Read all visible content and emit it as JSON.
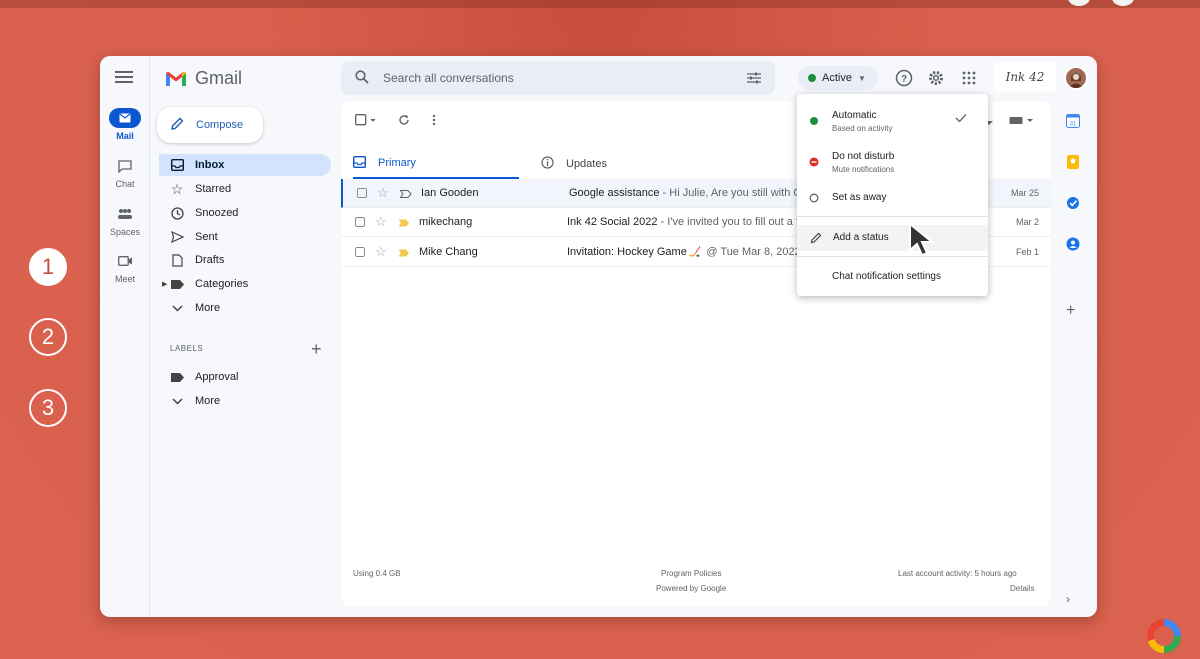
{
  "steps": [
    "1",
    "2",
    "3"
  ],
  "app": {
    "name": "Gmail"
  },
  "rail": {
    "items": [
      {
        "label": "Mail"
      },
      {
        "label": "Chat"
      },
      {
        "label": "Spaces"
      },
      {
        "label": "Meet"
      }
    ]
  },
  "search": {
    "placeholder": "Search all conversations"
  },
  "status": {
    "label": "Active",
    "color": "#1e8e3e"
  },
  "brand": {
    "text": "Ink 42"
  },
  "compose": {
    "label": "Compose"
  },
  "nav": {
    "items": [
      {
        "label": "Inbox",
        "icon": "inbox-icon"
      },
      {
        "label": "Starred",
        "icon": "star-icon"
      },
      {
        "label": "Snoozed",
        "icon": "clock-icon"
      },
      {
        "label": "Sent",
        "icon": "send-icon"
      },
      {
        "label": "Drafts",
        "icon": "draft-icon"
      },
      {
        "label": "Categories",
        "icon": "label-icon"
      },
      {
        "label": "More",
        "icon": "chevron-down-icon"
      }
    ],
    "labels_heading": "LABELS",
    "labels": [
      {
        "label": "Approval"
      },
      {
        "label": "More"
      }
    ]
  },
  "tabs": [
    {
      "label": "Primary"
    },
    {
      "label": "Updates"
    }
  ],
  "emails": [
    {
      "sender": "Ian Gooden",
      "subject": "Google assistance",
      "snippet": " - Hi Julie, Are you still with Go",
      "date": "Mar 25"
    },
    {
      "sender": "mikechang",
      "subject": "Ink 42 Social 2022",
      "snippet": " - I've invited you to fill out a fo",
      "date": "Mar 2"
    },
    {
      "sender": "Mike Chang",
      "subject": "Invitation: Hockey Game",
      "snippet": " @ Tue Mar 8, 2022",
      "date": "Feb 1"
    }
  ],
  "footer": {
    "storage": "Using 0.4 GB",
    "policies": "Program Policies",
    "powered": "Powered by Google",
    "activity": "Last account activity: 5 hours ago",
    "details": "Details"
  },
  "status_menu": {
    "automatic": {
      "label": "Automatic",
      "sub": "Based on activity"
    },
    "dnd": {
      "label": "Do not disturb",
      "sub": "Mute notifications"
    },
    "away": {
      "label": "Set as away"
    },
    "add_status": {
      "label": "Add a status"
    },
    "notif_settings": {
      "label": "Chat notification settings"
    }
  },
  "colors": {
    "accent": "#0b57d0",
    "background": "#d9604c",
    "green": "#1e8e3e",
    "red": "#d93025"
  }
}
